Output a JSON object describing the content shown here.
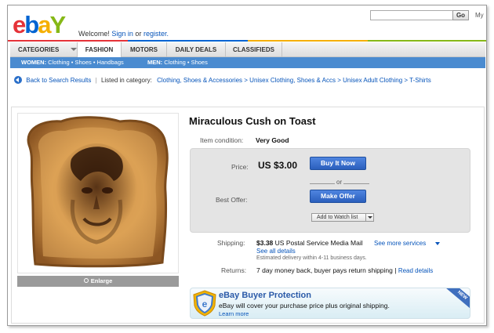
{
  "header": {
    "welcome_prefix": "Welcome!",
    "sign_in": "Sign in",
    "or": "or",
    "register": "register.",
    "search_placeholder": "",
    "go_label": "Go",
    "my_label": "My"
  },
  "nav": {
    "tabs": [
      {
        "label": "CATEGORIES"
      },
      {
        "label": "FASHION"
      },
      {
        "label": "MOTORS"
      },
      {
        "label": "DAILY DEALS"
      },
      {
        "label": "CLASSIFIEDS"
      }
    ],
    "active_tab": "FASHION"
  },
  "subnav": {
    "women_label": "WOMEN:",
    "women_links": "Clothing • Shoes • Handbags",
    "men_label": "MEN:",
    "men_links": "Clothing • Shoes"
  },
  "breadcrumb": {
    "back": "Back to Search Results",
    "sep": "|",
    "listed_in": "Listed in category:",
    "path": "Clothing, Shoes & Accessories > Unisex Clothing, Shoes & Accs > Unisex Adult Clothing > T-Shirts"
  },
  "item": {
    "title": "Miraculous Cush on Toast",
    "condition_label": "Item condition:",
    "condition_value": "Very Good",
    "price_label": "Price:",
    "price_value": "US $3.00",
    "buy_now": "Buy It Now",
    "or": "or",
    "best_offer_label": "Best Offer:",
    "make_offer": "Make Offer",
    "watch_list": "Add to Watch list",
    "enlarge": "Enlarge"
  },
  "shipping": {
    "label": "Shipping:",
    "cost": "$3.38",
    "method": "US Postal Service Media Mail",
    "see_more": "See more services",
    "see_all": "See all details",
    "estimate": "Estimated delivery within 4-11 business days.",
    "returns_label": "Returns:",
    "returns_value": "7 day money back, buyer pays return shipping |",
    "read_details": "Read details"
  },
  "protection": {
    "title": "eBay Buyer Protection",
    "text": "eBay will cover your purchase price plus original shipping.",
    "link": "Learn more",
    "badge": "NEW"
  },
  "colors": {
    "ebay_red": "#e53238",
    "ebay_blue": "#0064d2",
    "ebay_yellow": "#f5af02",
    "ebay_green": "#86b817",
    "link": "#0654ba",
    "subnav_bg": "#4a8bd0"
  }
}
